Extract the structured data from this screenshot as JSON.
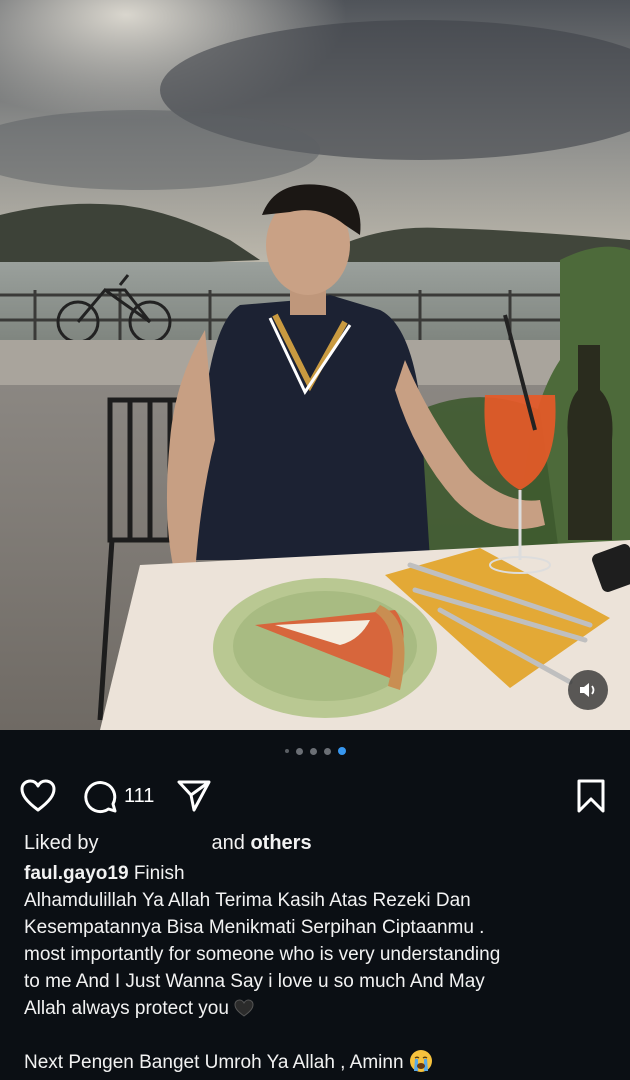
{
  "post": {
    "carousel": {
      "total": 5,
      "active_index": 4
    },
    "actions": {
      "comment_count": "111"
    },
    "likes": {
      "prefix": "Liked by",
      "suffix_and": "and",
      "suffix_others": "others"
    },
    "caption": {
      "username": "faul.gayo19",
      "first_line_text": "Finish",
      "lines": [
        "Alhamdulillah Ya Allah Terima Kasih Atas Rezeki Dan",
        "Kesempatannya Bisa Menikmati Serpihan Ciptaanmu .",
        "most importantly for someone who is very understanding",
        "to me And I Just Wanna Say i love u so much And May",
        "Allah always protect you"
      ],
      "last_line": "Next Pengen Banget Umroh Ya Allah , Aminn"
    }
  },
  "icons": {
    "like": "heart-outline-icon",
    "comment": "comment-bubble-icon",
    "share": "paper-plane-icon",
    "save": "bookmark-icon",
    "audio": "speaker-icon"
  },
  "colors": {
    "background": "#0b0f14",
    "text": "#f2f2f2",
    "active_dot": "#3797f0"
  }
}
